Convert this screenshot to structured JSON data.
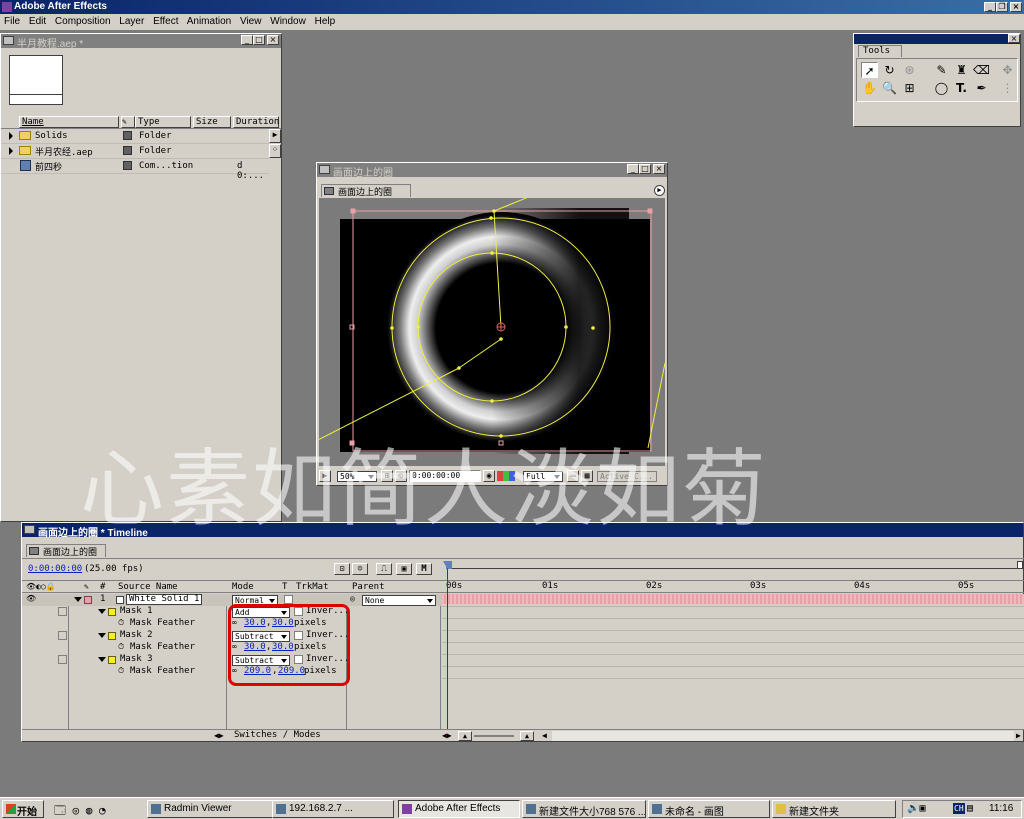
{
  "app": {
    "title": "Adobe After Effects"
  },
  "menu": [
    "File",
    "Edit",
    "Composition",
    "Layer",
    "Effect",
    "Animation",
    "View",
    "Window",
    "Help"
  ],
  "project": {
    "title": "半月教程.aep *",
    "columns": [
      "Name",
      "Type",
      "Size",
      "Duration"
    ],
    "items": [
      {
        "name": "Solids",
        "type": "Folder",
        "duration": ""
      },
      {
        "name": "半月农经.aep",
        "type": "Folder",
        "duration": ""
      },
      {
        "name": "前四秒",
        "type": "Com...tion",
        "duration": "d 0:..."
      }
    ]
  },
  "tools": {
    "title": "Tools",
    "text_tool": "T."
  },
  "comp": {
    "title": "画面边上的圈",
    "tab": "画面边上的圈",
    "zoom": "50%",
    "timecode": "0:00:00:00",
    "resolution": "Full",
    "camera": "Active C..."
  },
  "timeline": {
    "title": "画面边上的圈 * Timeline",
    "tab": "画面边上的圈",
    "time": "0:00:00:00",
    "fps": "(25.00 fps)",
    "columns": {
      "hash": "#",
      "source": "Source Name",
      "mode": "Mode",
      "t": "T",
      "trkmat": "TrkMat",
      "parent": "Parent"
    },
    "ruler": [
      "00s",
      "01s",
      "02s",
      "03s",
      "04s",
      "05s"
    ],
    "layer": {
      "num": "1",
      "name": "White Solid 1",
      "mode": "Normal",
      "parent": "None"
    },
    "masks": [
      {
        "name": "Mask 1",
        "mode": "Add",
        "inverted": "Inver...",
        "feather_label": "Mask Feather",
        "feather_x": "30.0",
        "feather_y": "30.0"
      },
      {
        "name": "Mask 2",
        "mode": "Subtract",
        "inverted": "Inver...",
        "feather_label": "Mask Feather",
        "feather_x": "30.0",
        "feather_y": "30.0"
      },
      {
        "name": "Mask 3",
        "mode": "Subtract",
        "inverted": "Inver...",
        "feather_label": "Mask Feather",
        "feather_x": "209.0",
        "feather_y": "209.0"
      }
    ],
    "units": "pixels",
    "switches": "Switches / Modes",
    "comma": ","
  },
  "watermark": "心素如简人淡如菊",
  "taskbar": {
    "start": "开始",
    "buttons": [
      "Radmin Viewer",
      "192.168.2.7",
      "Adobe After Effects",
      "新建文件大小768 576 ...",
      "未命名 - 画图",
      "新建文件夹"
    ],
    "ime": "CH",
    "clock": "11:16"
  },
  "colors": {
    "title_active": "#0a246a",
    "panel": "#d4d0c8",
    "desktop": "#7b7b7b",
    "mask_path": "#f0f040",
    "highlight": "#e00000",
    "work_area": "#e8a0a8"
  }
}
